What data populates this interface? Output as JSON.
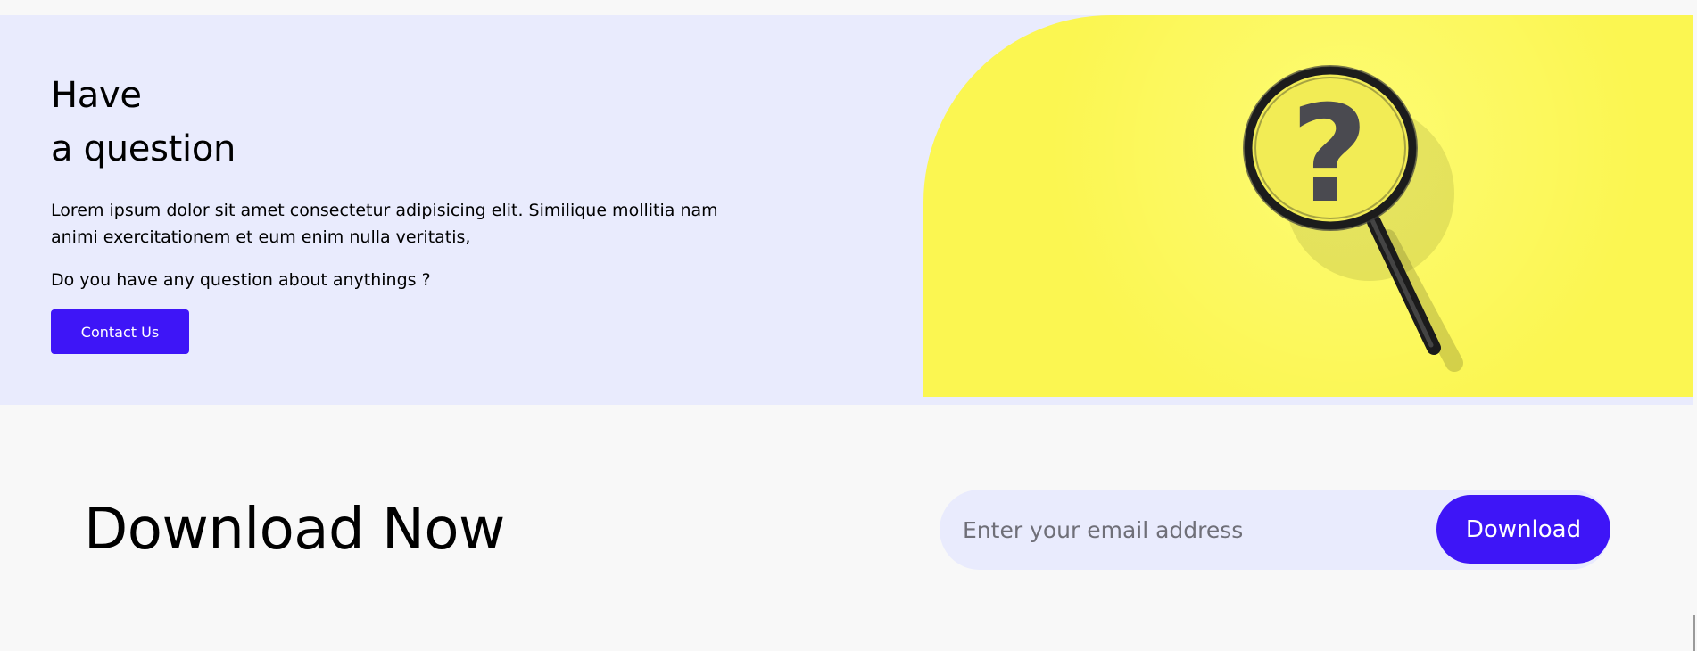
{
  "question": {
    "title_line1": "Have",
    "title_line2": "a question",
    "description": "Lorem ipsum dolor sit amet consectetur adipisicing elit. Similique mollitia nam animi exercitationem et eum enim nulla veritatis,",
    "ask": "Do you have any question about anythings ?",
    "contact_label": "Contact Us"
  },
  "download": {
    "title": "Download Now",
    "email_placeholder": "Enter your email address",
    "button_label": "Download"
  },
  "colors": {
    "accent": "#3e15f7",
    "banner_bg": "#e9ebfd",
    "image_bg": "#fbf651"
  },
  "icons": {
    "image": "magnifying-glass-question-mark"
  }
}
